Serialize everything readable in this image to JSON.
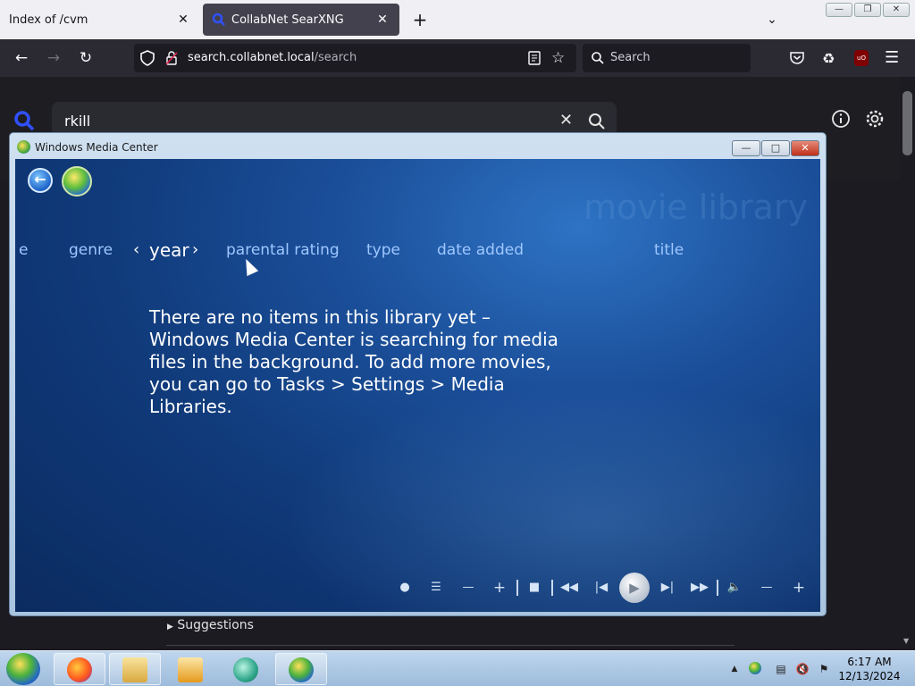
{
  "browser": {
    "tabs": [
      {
        "label": "Index of /cvm",
        "active": false
      },
      {
        "label": "CollabNet SearXNG",
        "active": true
      }
    ],
    "url_host": "search.collabnet.local",
    "url_path": "/search",
    "search_placeholder": "Search"
  },
  "page": {
    "query": "rkill",
    "suggestions_label": "Suggestions"
  },
  "wmc": {
    "window_title": "Windows Media Center",
    "watermark": "movie library",
    "nav": {
      "partial": "e",
      "genre": "genre",
      "year": "year",
      "parental_rating": "parental rating",
      "type": "type",
      "date_added": "date added",
      "title": "title"
    },
    "message": "There are no items in this library yet – Windows Media Center is searching for media files in the background. To add more movies, you can go to Tasks > Settings > Media Libraries."
  },
  "taskbar": {
    "time": "6:17 AM",
    "date": "12/13/2024"
  },
  "colors": {
    "wmc_text_selected": "#ffffff",
    "wmc_text_nav": "#9ec7ff",
    "browser_bg": "#1c1b22"
  }
}
